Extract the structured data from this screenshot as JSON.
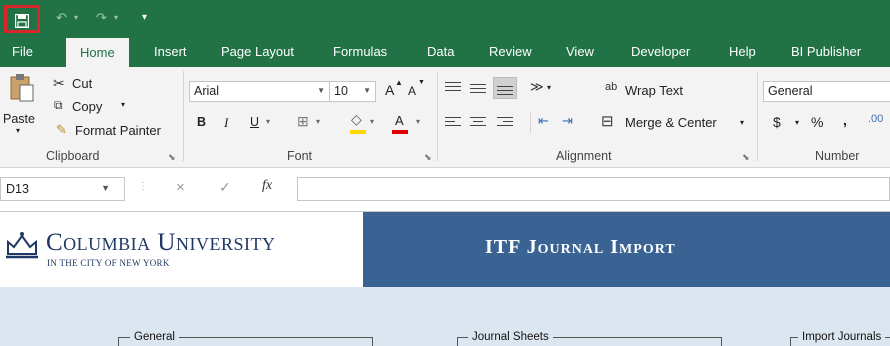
{
  "tabs": [
    "File",
    "Home",
    "Insert",
    "Page Layout",
    "Formulas",
    "Data",
    "Review",
    "View",
    "Developer",
    "Help",
    "BI Publisher"
  ],
  "clipboard": {
    "paste": "Paste",
    "cut": "Cut",
    "copy": "Copy",
    "format_painter": "Format Painter",
    "label": "Clipboard"
  },
  "font": {
    "name": "Arial",
    "size": "10",
    "label": "Font",
    "bold": "B",
    "italic": "I",
    "underline": "U",
    "grow": "A",
    "shrink": "A",
    "color_letter": "A"
  },
  "alignment": {
    "wrap_text": "Wrap Text",
    "merge_center": "Merge & Center",
    "label": "Alignment"
  },
  "number": {
    "format": "General",
    "currency": "$",
    "percent": "%",
    "comma": ",",
    "label": "Number"
  },
  "formula_bar": {
    "name_box": "D13",
    "fx": "fx",
    "formula": ""
  },
  "sheet": {
    "org_name": "Columbia University",
    "org_sub": "In the City of New York",
    "title": "ITF Journal Import",
    "sections": [
      "General",
      "Journal Sheets",
      "Import Journals"
    ]
  },
  "colors": {
    "excel_green": "#217346",
    "highlight_red": "#d9262c",
    "banner_blue": "#3a6394",
    "sheet_bg": "#dce6f0"
  }
}
